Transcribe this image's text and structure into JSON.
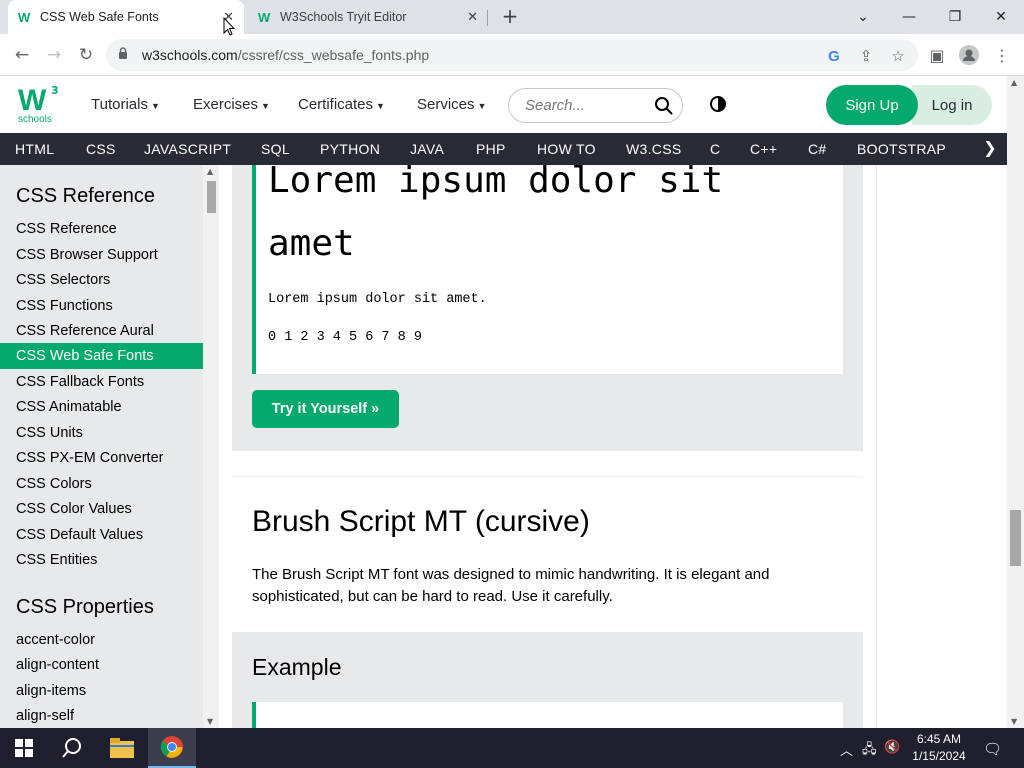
{
  "browser": {
    "tabs": [
      {
        "title": "CSS Web Safe Fonts",
        "favicon": "W"
      },
      {
        "title": "W3Schools Tryit Editor",
        "favicon": "W"
      }
    ],
    "url_host": "w3schools.com",
    "url_path": "/cssref/css_websafe_fonts.php"
  },
  "header": {
    "logo_main": "W",
    "logo_sup": "3",
    "logo_sub": "schools",
    "menu": [
      "Tutorials",
      "Exercises",
      "Certificates",
      "Services"
    ],
    "search_placeholder": "Search...",
    "signup": "Sign Up",
    "login": "Log in"
  },
  "subjects": [
    "HTML",
    "CSS",
    "JAVASCRIPT",
    "SQL",
    "PYTHON",
    "JAVA",
    "PHP",
    "HOW TO",
    "W3.CSS",
    "C",
    "C++",
    "C#",
    "BOOTSTRAP"
  ],
  "sidebar": {
    "heading1": "CSS Reference",
    "items1": [
      "CSS Reference",
      "CSS Browser Support",
      "CSS Selectors",
      "CSS Functions",
      "CSS Reference Aural",
      "CSS Web Safe Fonts",
      "CSS Fallback Fonts",
      "CSS Animatable",
      "CSS Units",
      "CSS PX-EM Converter",
      "CSS Colors",
      "CSS Color Values",
      "CSS Default Values",
      "CSS Entities"
    ],
    "active_index": 5,
    "heading2": "CSS Properties",
    "items2": [
      "accent-color",
      "align-content",
      "align-items",
      "align-self"
    ]
  },
  "main": {
    "lorem_big_1": "Lorem ipsum dolor sit",
    "lorem_big_2": "amet",
    "lorem_small": "Lorem ipsum dolor sit amet.",
    "digits": "0 1 2 3 4 5 6 7 8 9",
    "try_button": "Try it Yourself »",
    "section_title": "Brush Script MT (cursive)",
    "section_text": "The Brush Script MT font was designed to mimic handwriting. It is elegant and sophisticated, but can be hard to read. Use it carefully.",
    "example_title": "Example"
  },
  "taskbar": {
    "time": "6:45 AM",
    "date": "1/15/2024"
  },
  "colors": {
    "brand": "#04aa6d",
    "dark_bar": "#282a35",
    "sidebar_bg": "#e7e9eb"
  }
}
